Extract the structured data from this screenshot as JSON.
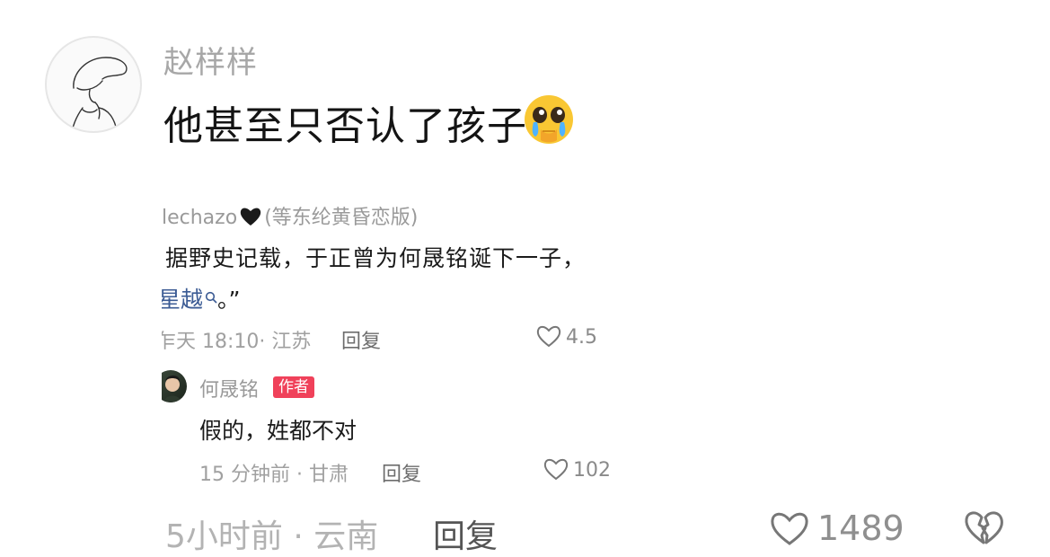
{
  "comment": {
    "username": "赵样样",
    "text": "他甚至只否认了孩子",
    "time_location": "5小时前 · 云南",
    "reply_label": "回复",
    "like_count": "1489"
  },
  "embedded": {
    "original": {
      "username": "lechazo",
      "username_suffix": "(等东纶黄昏恋版)",
      "text_line1": "据野史记载，于正曾为何晟铭诞下一子，",
      "link_text": "星越",
      "text_line2_rest": "。”",
      "time_location": "乍天 18:10· 江苏",
      "reply_label": "回复",
      "like_count": "4.5"
    },
    "reply": {
      "username": "何晟铭",
      "badge": "作者",
      "text": "假的，姓都不对",
      "time_location": "15 分钟前 · 甘肃",
      "reply_label": "回复",
      "like_count": "102"
    }
  },
  "colors": {
    "badge": "#f0415a",
    "link": "#3b5b94",
    "meta": "#b3b3b3"
  },
  "icons": [
    "avatar-hat-sketch",
    "pleading-crying-emoji",
    "black-heart-icon",
    "search-icon",
    "heart-outline-icon",
    "broken-heart-icon"
  ]
}
